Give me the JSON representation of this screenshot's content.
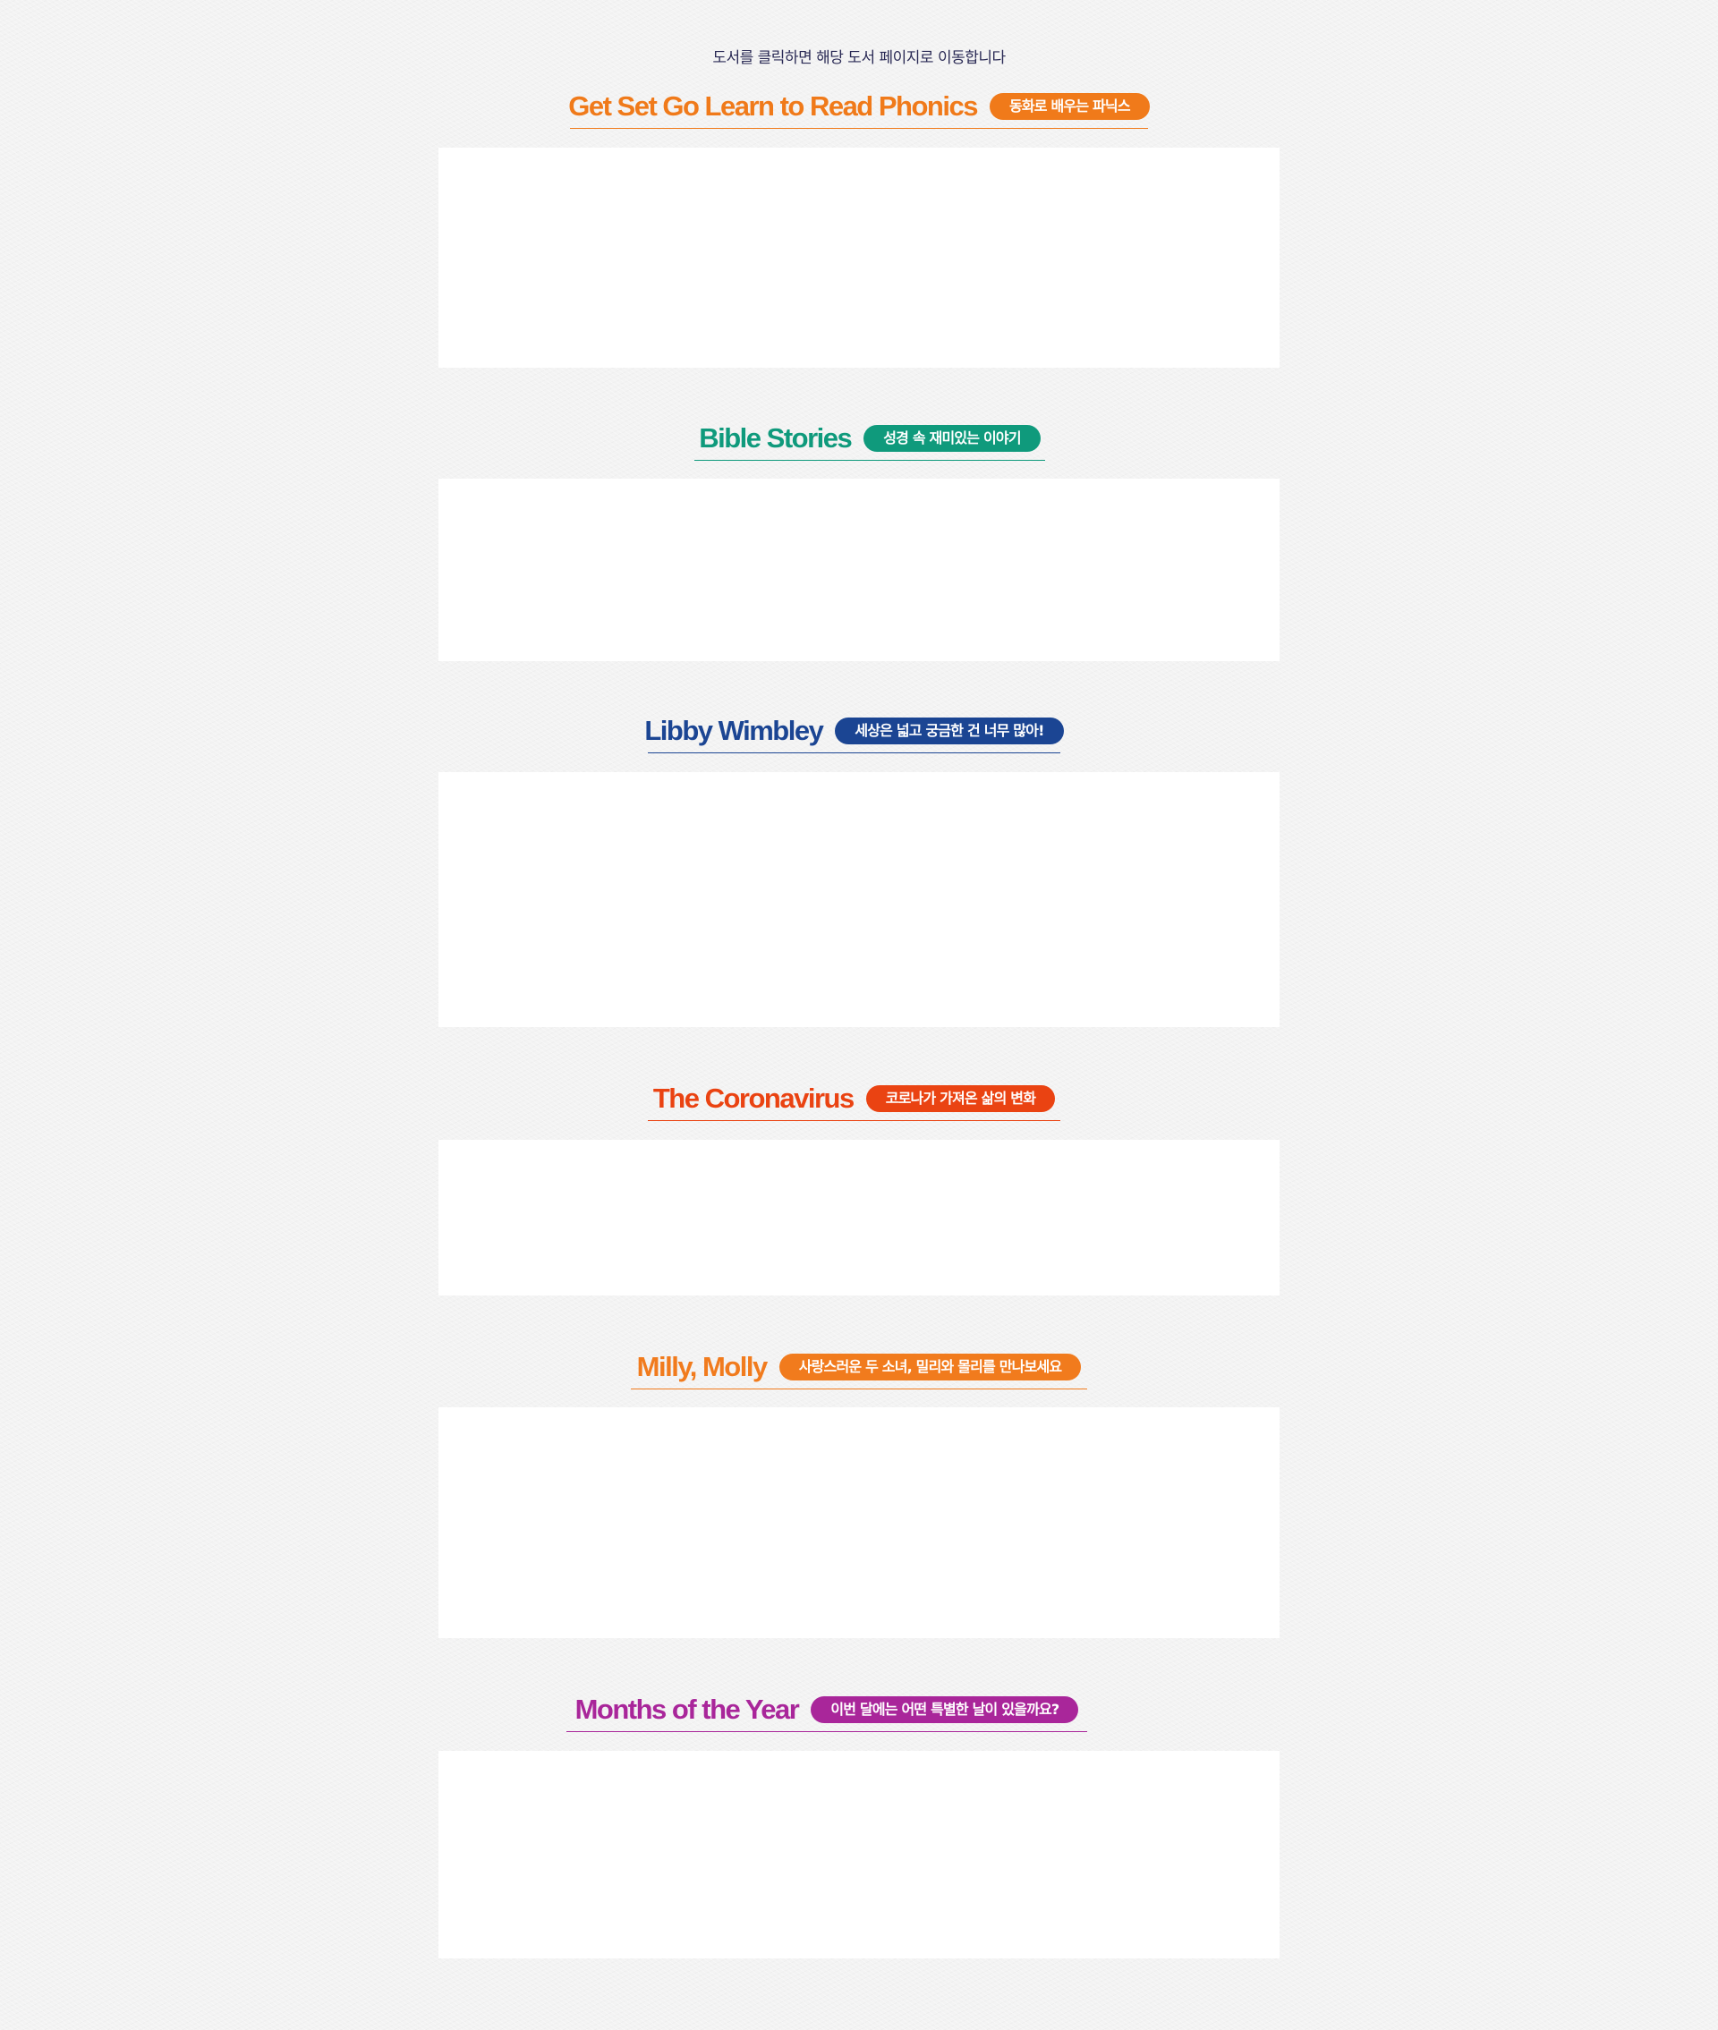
{
  "notice": "도서를 클릭하면 해당 도서 페이지로 이동합니다",
  "sections": [
    {
      "title": "Get Set Go Learn to Read Phonics",
      "badge": "동화로 배우는 파닉스",
      "color": "#f07a1a"
    },
    {
      "title": "Bible Stories",
      "badge": "성경 속 재미있는 이야기",
      "color": "#0f9a7c"
    },
    {
      "title": "Libby Wimbley",
      "badge": "세상은 넓고 궁금한 건 너무 많아!",
      "color": "#1b4593"
    },
    {
      "title": "The Coronavirus",
      "badge": "코로나가 가져온 삶의 변화",
      "color": "#ea4312"
    },
    {
      "title": "Milly, Molly",
      "badge": "사랑스러운 두 소녀, 밀리와 몰리를 만나보세요",
      "color": "#f17b1d"
    },
    {
      "title": "Months of the Year",
      "badge": "이번 달에는 어떤 특별한 날이 있을까요?",
      "color": "#a9269a"
    }
  ]
}
